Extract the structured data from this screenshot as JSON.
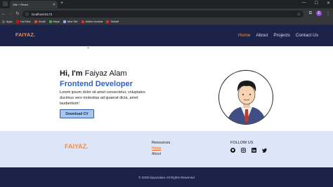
{
  "browser": {
    "tab_title": "Vite + React",
    "new_tab_glyph": "+",
    "url": "localhost:5173",
    "bookmarks": [
      {
        "label": "Apps",
        "icon_color": "#5f6368"
      },
      {
        "label": "YouTube",
        "icon_color": "#ff0000"
      },
      {
        "label": "Gmail",
        "icon_color": "#ea4335"
      },
      {
        "label": "Maps",
        "icon_color": "#34a853"
      },
      {
        "label": "New Tab",
        "icon_color": "#8ab4f8"
      },
      {
        "label": "Adobe Acrobat",
        "icon_color": "#d93025"
      },
      {
        "label": "Sinkalf",
        "icon_color": "#d93025"
      }
    ],
    "profile_initial": "E"
  },
  "site": {
    "brand_color": "#ff8c3a",
    "nav_bg": "#1c2349",
    "logo": "FAIYAZ.",
    "menu": [
      "Home",
      "About",
      "Projects",
      "Contact Us"
    ],
    "active_menu_index": 0
  },
  "hero": {
    "greeting": "Hi, I'm ",
    "name": "Faiyaz Alam",
    "role": "Frontend Developer",
    "text": "Lorem ipsum dolor sit amet consectetur, voluptates ducimus vero molestias ad quaerat dicta, amet laudantium!",
    "button": "Download CV"
  },
  "footer": {
    "logo": "FAIYAZ.",
    "resources_heading": "Resources",
    "resources_links": [
      "Home",
      "About"
    ],
    "follow_heading": "FOLLOW US",
    "social_icons": [
      "github-icon",
      "instagram-icon",
      "linkedin-icon",
      "twitter-icon"
    ],
    "copyright": "© 2025 faiyazalam.All Rights Reserved"
  }
}
